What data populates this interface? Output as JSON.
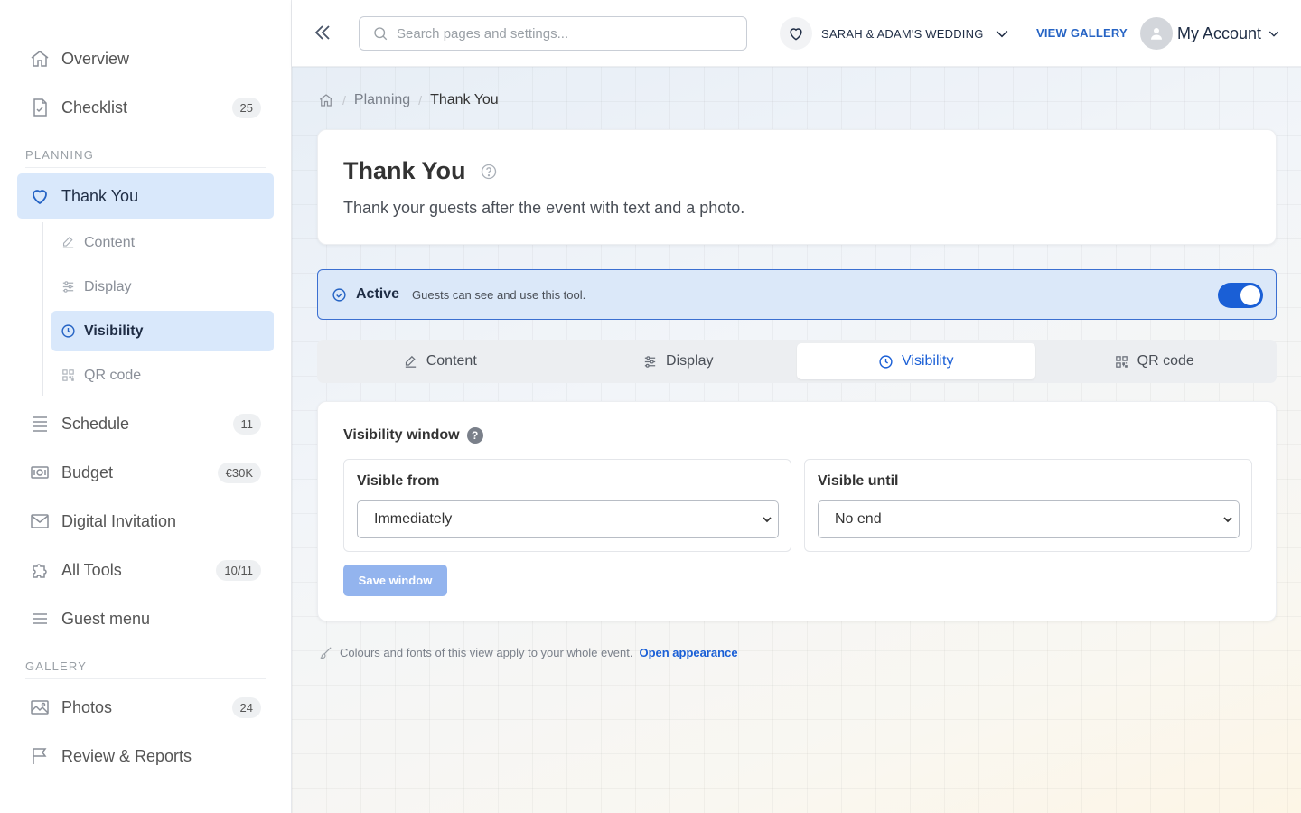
{
  "sidebar": {
    "top_items": [
      {
        "label": "Overview",
        "icon": "home-icon"
      },
      {
        "label": "Checklist",
        "icon": "checklist-icon",
        "badge": "25"
      }
    ],
    "planning_label": "PLANNING",
    "active_item": {
      "label": "Thank You",
      "icon": "heart-icon"
    },
    "sub_items": [
      {
        "label": "Content",
        "icon": "edit-icon"
      },
      {
        "label": "Display",
        "icon": "sliders-icon"
      },
      {
        "label": "Visibility",
        "icon": "clock-icon"
      },
      {
        "label": "QR code",
        "icon": "qr-icon"
      }
    ],
    "planning_items": [
      {
        "label": "Schedule",
        "icon": "list-icon",
        "badge": "11"
      },
      {
        "label": "Budget",
        "icon": "money-icon",
        "badge": "€30K"
      },
      {
        "label": "Digital Invitation",
        "icon": "mail-icon"
      },
      {
        "label": "All Tools",
        "icon": "puzzle-icon",
        "badge": "10/11"
      },
      {
        "label": "Guest menu",
        "icon": "menu-icon"
      }
    ],
    "gallery_label": "GALLERY",
    "gallery_items": [
      {
        "label": "Photos",
        "icon": "image-icon",
        "badge": "24"
      },
      {
        "label": "Review & Reports",
        "icon": "flag-icon"
      }
    ]
  },
  "topbar": {
    "search_placeholder": "Search pages and settings...",
    "event_name": "SARAH & ADAM'S WEDDING",
    "view_gallery": "VIEW GALLERY",
    "account_label": "My Account"
  },
  "breadcrumb": {
    "parent": "Planning",
    "current": "Thank You"
  },
  "page": {
    "title": "Thank You",
    "description": "Thank your guests after the event with text and a photo."
  },
  "status": {
    "label": "Active",
    "description": "Guests can see and use this tool.",
    "enabled": true
  },
  "tabs": [
    {
      "label": "Content",
      "icon": "edit-icon"
    },
    {
      "label": "Display",
      "icon": "sliders-icon"
    },
    {
      "label": "Visibility",
      "icon": "clock-icon",
      "active": true
    },
    {
      "label": "QR code",
      "icon": "qr-icon"
    }
  ],
  "visibility": {
    "heading": "Visibility window",
    "help_glyph": "?",
    "from_label": "Visible from",
    "from_value": "Immediately",
    "until_label": "Visible until",
    "until_value": "No end",
    "save_label": "Save window"
  },
  "footnote": {
    "text": "Colours and fonts of this view apply to your whole event.",
    "link": "Open appearance"
  },
  "colors": {
    "accent": "#1a5fd6",
    "active_bg": "#d9e8fb",
    "save_disabled": "#93b4ee"
  }
}
